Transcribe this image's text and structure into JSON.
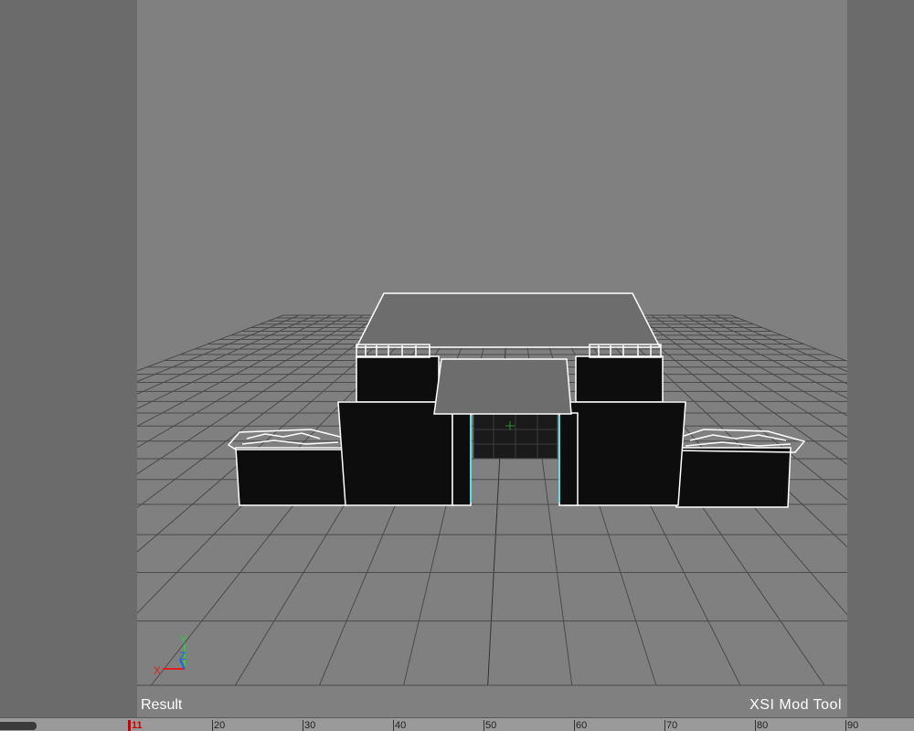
{
  "viewport": {
    "left_label": "Result",
    "right_label": "XSI  Mod  Tool"
  },
  "axis_gizmo": {
    "x": "X",
    "y": "Y",
    "z": "Z"
  },
  "timeline": {
    "current_frame": "11",
    "ticks": [
      "20",
      "30",
      "40",
      "50",
      "60",
      "70",
      "80",
      "90"
    ]
  },
  "colors": {
    "viewport_bg": "#808080",
    "grid": "#4a4a4a",
    "mesh_fill": "#0d0d0d",
    "wire_selected": "#ffffff",
    "wire_highlight": "#5ae0e0"
  }
}
